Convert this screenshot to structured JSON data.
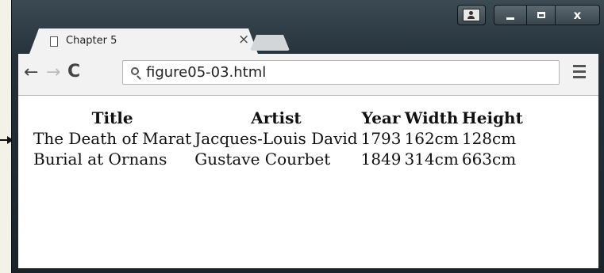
{
  "tab": {
    "title": "Chapter 5",
    "close": "×"
  },
  "toolbar": {
    "url": "figure05-03.html"
  },
  "table": {
    "headers": [
      "Title",
      "Artist",
      "Year",
      "Width",
      "Height"
    ],
    "rows": [
      [
        "The Death of Marat",
        "Jacques-Louis David",
        "1793",
        "162cm",
        "128cm"
      ],
      [
        "Burial at Ornans",
        "Gustave Courbet",
        "1849",
        "314cm",
        "663cm"
      ]
    ]
  }
}
